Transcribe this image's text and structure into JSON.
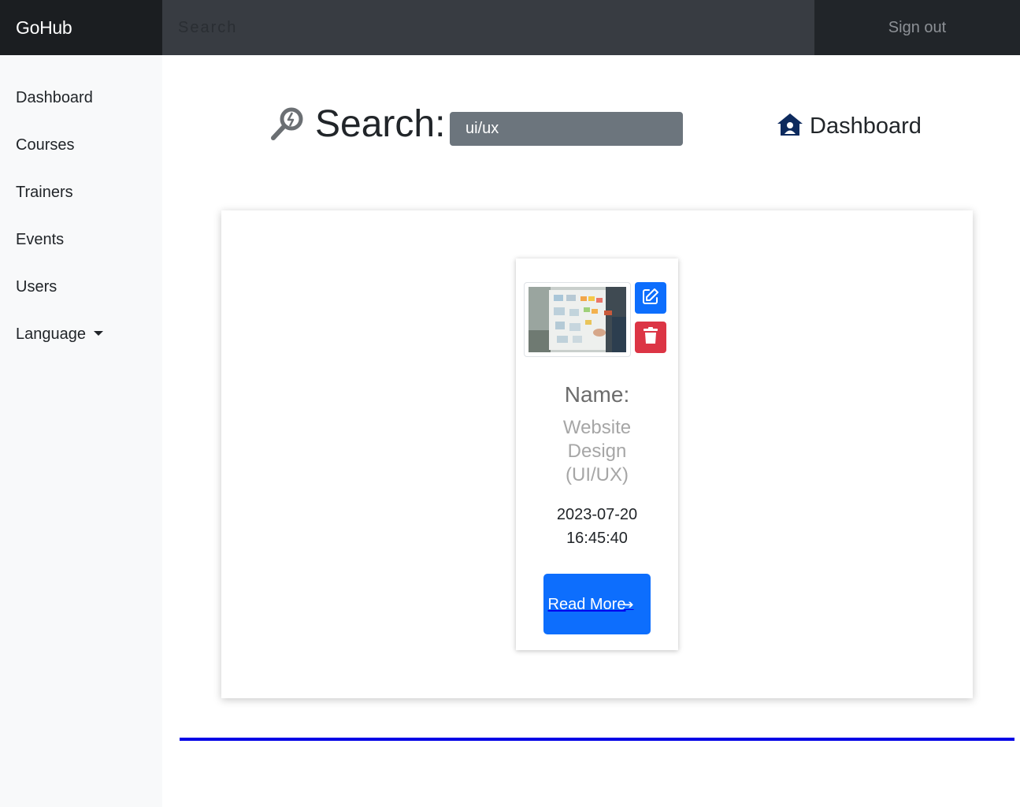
{
  "navbar": {
    "brand": "GoHub",
    "search_placeholder": "Search",
    "signout_label": "Sign out"
  },
  "sidebar": {
    "items": [
      {
        "label": "Dashboard"
      },
      {
        "label": "Courses"
      },
      {
        "label": "Trainers"
      },
      {
        "label": "Events"
      },
      {
        "label": "Users"
      },
      {
        "label": "Language"
      }
    ]
  },
  "search": {
    "title": "Search:",
    "value": "ui/ux"
  },
  "dashboard_link": {
    "label": "Dashboard"
  },
  "results": [
    {
      "name_label": "Name:",
      "name": "Website Design (UI/UX)",
      "date": "2023-07-20 16:45:40",
      "read_more_label": "Read More"
    }
  ],
  "colors": {
    "navbar": "#212529",
    "sidebar": "#f8f9fa",
    "primary": "#0d6efd",
    "danger": "#dc3545",
    "search_field": "#6c757d",
    "divider": "#0000e6"
  }
}
